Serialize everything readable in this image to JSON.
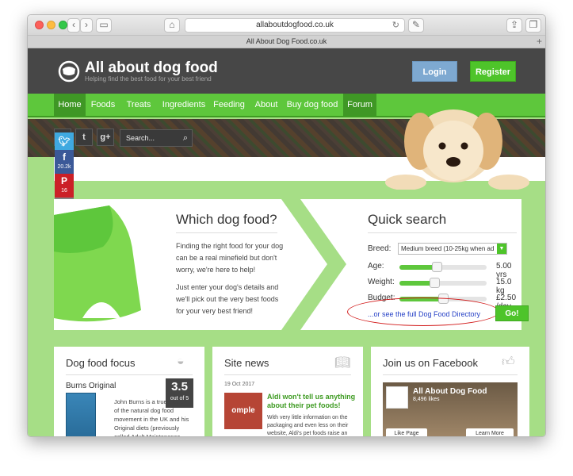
{
  "browser": {
    "address": "allaboutdogfood.co.uk",
    "tab_title": "All About Dog Food.co.uk"
  },
  "site": {
    "brand": "All about dog food",
    "tagline": "Helping find the best food for your best friend",
    "login_label": "Login",
    "register_label": "Register",
    "menu": [
      "Home",
      "Foods",
      "Treats",
      "Ingredients",
      "Feeding",
      "About",
      "Buy dog food",
      "Forum"
    ],
    "search_placeholder": "Search..."
  },
  "share": {
    "facebook_count": "20.2k",
    "pinterest_count": "16"
  },
  "which": {
    "title": "Which dog food?",
    "p1": "Finding the right food for your dog can be a real minefield but don't worry, we're here to help!",
    "p2": "Just enter your dog's details and we'll pick out the very best foods for your very best friend!"
  },
  "quick_search": {
    "title": "Quick search",
    "breed_label": "Breed:",
    "breed_value": "Medium breed (10-25kg when ad",
    "age_label": "Age:",
    "age_value": "5.00 yrs",
    "age_level": 0.43,
    "weight_label": "Weight:",
    "weight_value": "15.0 kg",
    "weight_level": 0.4,
    "budget_label": "Budget:",
    "budget_value": "£2.50 /day",
    "budget_level": 0.5,
    "directory_link": "...or see the full Dog Food Directory",
    "go_label": "Go!"
  },
  "focus": {
    "title": "Dog food focus",
    "product_name": "Burns Original",
    "rating": "3.5",
    "rating_outof": "out of 5",
    "text": "John Burns is a true pioneer of the natural dog food movement in the UK and his Original diets (previously called Adult Maintenance diets) have"
  },
  "news": {
    "title": "Site news",
    "date": "19 Oct 2017",
    "headline": "Aldi won't tell us anything about their pet foods!",
    "text": "With very little information on the packaging and even less on their website, Aldi's pet foods raise an",
    "thumb_text": "omple"
  },
  "facebook": {
    "title": "Join us on Facebook",
    "page_name": "All About Dog Food",
    "likes": "8,496 likes",
    "like_page": "Like Page",
    "learn_more": "Learn More"
  },
  "colors": {
    "brand_green": "#5ec73c",
    "header_gray": "#474747",
    "login_blue": "#7ea9d1",
    "annotation_red": "#d21c1c"
  }
}
